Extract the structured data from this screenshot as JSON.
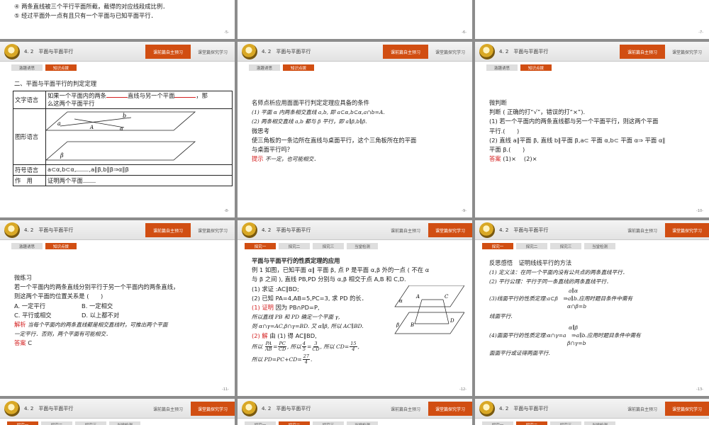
{
  "header": {
    "section_label": "4. 2　平面与平面平行",
    "btn_preview": "课前篇自主预习",
    "btn_explore": "课堂篇探究学习"
  },
  "preview_tabs": [
    "激趣诱思",
    "知识点拨"
  ],
  "explore_tabs": [
    "探究一",
    "探究二",
    "探究三",
    "当堂检测"
  ],
  "s_top1": {
    "line4": "④ 两条直线被三个平行平面所截，截得的对应线段成比例．",
    "line5": "⑤ 经过平面外一点有且只有一个平面与已知平面平行．",
    "page": "-5-"
  },
  "s_top2": {
    "page": "-6-"
  },
  "s_top3": {
    "page": "-7-"
  },
  "s8": {
    "heading": "二、平面与平面平行的判定定理",
    "r1_label": "文字语言",
    "r1_text_a": "如果一个平面内的两条",
    "r1_text_b": "直线与另一个平面",
    "r1_text_c": "，那",
    "r1_text_d": "么这两个平面平行",
    "r2_label": "图形语言",
    "r3_label": "符号语言",
    "r3_text": "a⊂α,b⊂α,",
    "r3_text2": ",a∥β,b∥β⇒α∥β",
    "r4_label": "作　用",
    "r4_text": "证明两个平面",
    "page": "-8-"
  },
  "s9": {
    "l1": "名师点析应用面面平行判定定理应具备的条件",
    "l2": "(1) 平面 α 内两条相交直线 a,b, 即 a⊂α,b⊂α,a∩b=A.",
    "l3": "(2) 两条相交直线 a,b 都与 β 平行，即 a∥β,b∥β.",
    "l4": "微思考",
    "l5": "使三角板的一条边所在直线与桌面平行，这个三角板所在的平面",
    "l6": "与桌面平行吗？",
    "hint_label": "提示",
    "hint_text": " 不一定，也可能相交．",
    "page": "-9-"
  },
  "s10": {
    "l1": "微判断",
    "l2": "判断 ( 正确的打“√”，错误的打“×”).",
    "l3": "(1) 若一个平面内的两条直线都与另一个平面平行，则这两个平面",
    "l4": "平行.(　　)",
    "l5": "(2) 直线 a∥平面 β, 直线 b∥平面 β,a⊂ 平面 α,b⊂ 平面 α⇒ 平面 α∥",
    "l6": "平面 β.(　　)",
    "ans_label": "答案",
    "ans_text": " (1)×　 (2)×",
    "page": "-10-"
  },
  "s11": {
    "l1": "微练习",
    "l2": "若一个平面内的两条直线分别平行于另一个平面内的两条直线，",
    "l3": "则这两个平面的位置关系是 (　　)",
    "optA": "A. 一定平行",
    "optB": "B. 一定相交",
    "optC": "C. 平行或相交",
    "optD": "D. 以上都不对",
    "ex_label": "解析",
    "ex_text1": " 当每个平面内的两条直线都是相交直线时，可推出两个平面",
    "ex_text2": "一定平行．否则，两个平面有可能相交．",
    "ans_label": "答案",
    "ans_text": " C",
    "page": "-11-"
  },
  "s12": {
    "title": "平面与平面平行的性质定理的应用",
    "l1": "例 1 如图，已知平面 α∥ 平面 β, 点 P 是平面 α,β 外的一点 ( 不在 α",
    "l2": "与 β 之间 ), 直线 PB,PD 分别与 α,β 相交于点 A,B 和 C,D.",
    "l3": "(1) 求证 :AC∥BD;",
    "l4": "(2) 已知 PA=4,AB=5,PC=3, 求 PD 的长．",
    "proof_label": "(1) 证明",
    "l5": " 因为 PB∩PD=P,",
    "l6": "所以直线 PB 和 PD 确定一个平面 γ,",
    "l7": "则 α∩γ=AC,β∩γ=BD. 又 α∥β, 所以 AC∥BD.",
    "sol_label": "(2) 解",
    "l8": " 由 (1) 得 AC∥BD,",
    "l9a": "所以",
    "f1n": "PA",
    "f1d": "AB",
    "f2n": "PC",
    "f2d": "CD",
    "l9b": "所以",
    "f3n": "4",
    "f3d": "5",
    "f4n": "3",
    "f4d": "CD",
    "l9c": "所以 CD=",
    "f5n": "15",
    "f5d": "4",
    "l10a": "所以 PD=PC+CD=",
    "f6n": "27",
    "f6d": "4",
    "fig": {
      "A": "A",
      "C": "C",
      "B": "B",
      "D": "D",
      "alpha": "α",
      "beta": "β"
    },
    "page": "-12-"
  },
  "s13": {
    "l1": "反思感悟　证明线线平行的方法",
    "l2": "(1) 定义法：在同一个平面内没有公共点的两条直线平行．",
    "l3": "(2) 平行公理：平行于同一条直线的两条直线平行．",
    "l4": "(3)线面平行的性质定理:a⊂β",
    "l4b": "α∩β=b",
    "l4c": "⇒a∥b.应用时题目条件中需有",
    "l4top": "a∥α",
    "l5": "线面平行.",
    "l6top": "α∥β",
    "l6": "(4)面面平行的性质定理:α∩γ=a",
    "l6b": "β∩γ=b",
    "l6c": "⇒a∥b.应用时题目条件中需有",
    "l7": "面面平行或证得两面平行.",
    "page": "-13-"
  }
}
